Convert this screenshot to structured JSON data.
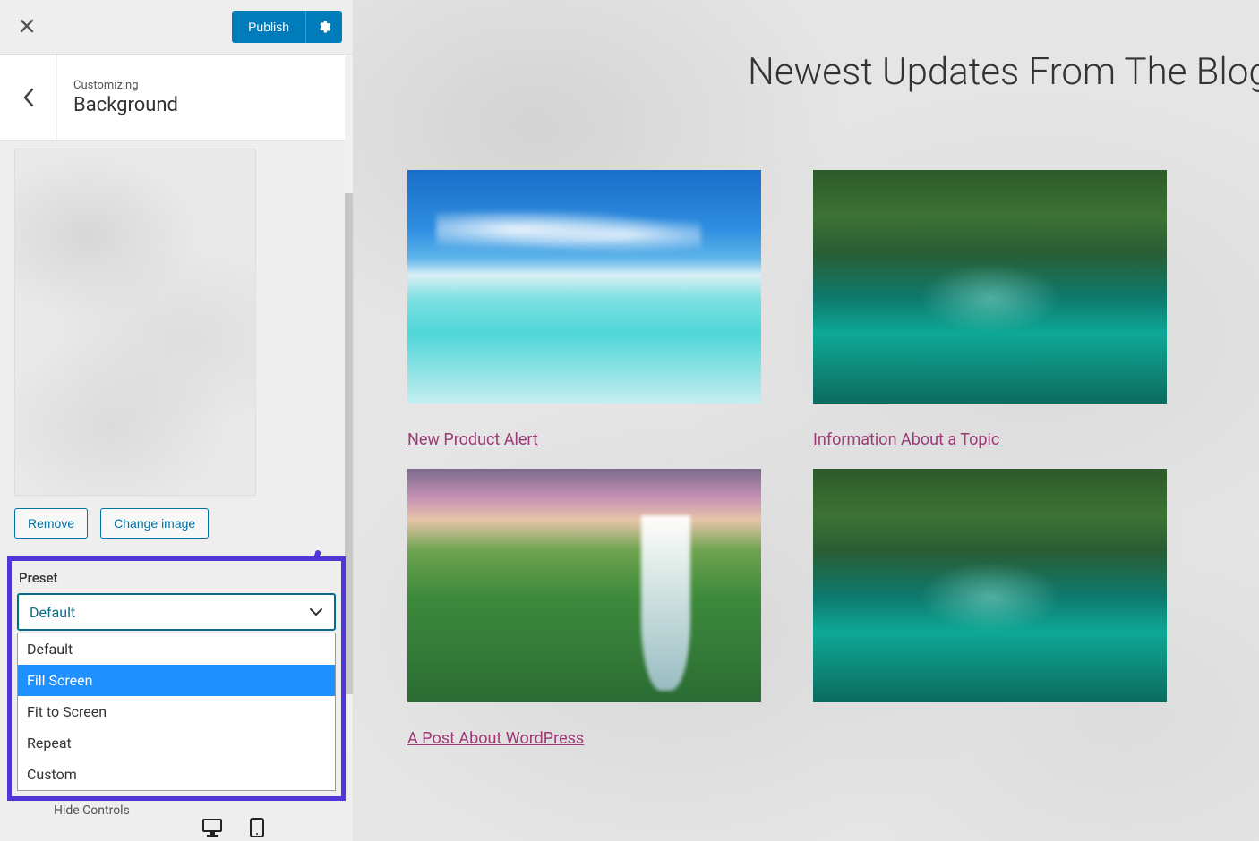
{
  "header": {
    "publish_label": "Publish"
  },
  "section": {
    "subtitle": "Customizing",
    "title": "Background"
  },
  "buttons": {
    "remove": "Remove",
    "change_image": "Change image"
  },
  "preset": {
    "label": "Preset",
    "selected": "Default",
    "options": [
      "Default",
      "Fill Screen",
      "Fit to Screen",
      "Repeat",
      "Custom"
    ],
    "highlighted_index": 1
  },
  "footer": {
    "hide_controls_fragment": "Hide Controls"
  },
  "preview": {
    "heading": "Newest Updates From The Blog",
    "cards": [
      {
        "link": "New Product Alert",
        "img": "beach"
      },
      {
        "link": "Information About a Topic",
        "img": "forest"
      },
      {
        "link": "A Post About WordPress",
        "img": "waterfall"
      },
      {
        "link": "",
        "img": "forest"
      }
    ]
  },
  "colors": {
    "primary": "#007cba",
    "link": "#9c3a76",
    "highlight_box": "#4f36d6",
    "option_highlight": "#1e90ff"
  }
}
